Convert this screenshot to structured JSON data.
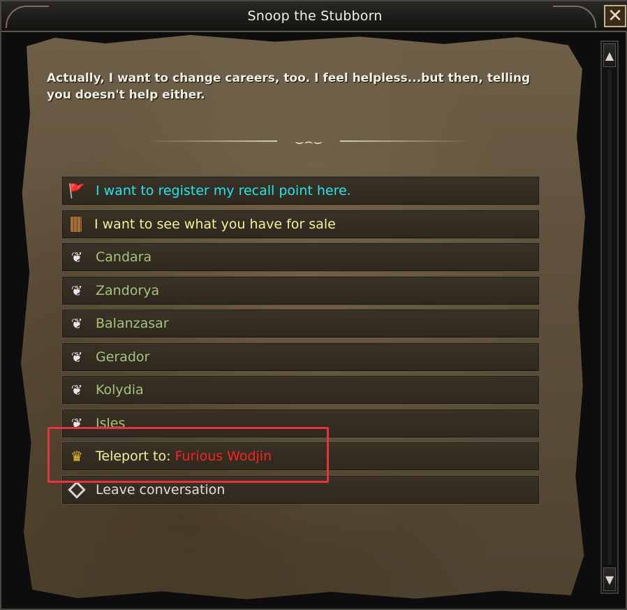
{
  "window": {
    "title": "Snoop the Stubborn",
    "close_glyph": "✕"
  },
  "dialog": {
    "intro_text": "Actually, I want to change careers, too. I feel helpless...but then, telling you doesn't help either.",
    "divider_glyph": "⌣⌢⌣"
  },
  "menu": {
    "items": [
      {
        "label": "I want to register my recall point here.",
        "icon": "flag-icon",
        "color": "#20e6f0"
      },
      {
        "label": "I want to see what you have for sale",
        "icon": "barrel-icon",
        "color": "#f3ef9a"
      },
      {
        "label": "Candara",
        "icon": "wing-icon",
        "color": "#a9c27b"
      },
      {
        "label": "Zandorya",
        "icon": "wing-icon",
        "color": "#a9c27b"
      },
      {
        "label": "Balanzasar",
        "icon": "wing-icon",
        "color": "#a9c27b"
      },
      {
        "label": "Gerador",
        "icon": "wing-icon",
        "color": "#a9c27b"
      },
      {
        "label": "Kolydia",
        "icon": "wing-icon",
        "color": "#a9c27b"
      },
      {
        "label": "Isles",
        "icon": "wing-icon",
        "color": "#a9c27b"
      },
      {
        "label_prefix": "Teleport to: ",
        "label_target": "Furious Wodjin",
        "icon": "crown-icon",
        "color": "#f3ef9a",
        "target_color": "#ff2020"
      },
      {
        "label": "Leave conversation",
        "icon": "diamond-icon",
        "color": "#e0ddd6"
      }
    ]
  },
  "icons": {
    "flag": "🚩",
    "wing": "❦",
    "crown": "♛"
  },
  "scrollbar": {
    "up_glyph": "▲",
    "down_glyph": "▼"
  }
}
